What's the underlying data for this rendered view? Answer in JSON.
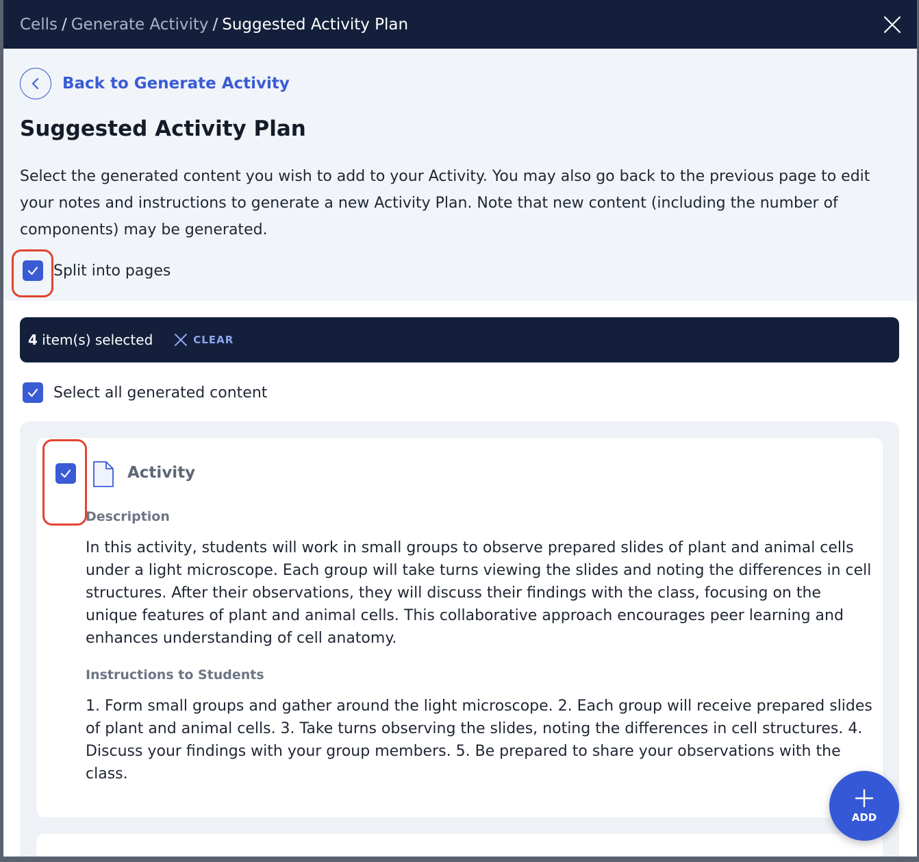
{
  "header": {
    "breadcrumb": [
      "Cells",
      "Generate Activity",
      "Suggested Activity Plan"
    ],
    "separator": "/"
  },
  "back_link": {
    "label": "Back to Generate Activity"
  },
  "page": {
    "title": "Suggested Activity Plan",
    "intro": "Select the generated content you wish to add to your Activity. You may also go back to the previous page to edit your notes and instructions to generate a new Activity Plan. Note that new content (including the number of components) may be generated."
  },
  "split_pages": {
    "label": "Split into pages",
    "checked": true
  },
  "selection_bar": {
    "count": "4",
    "suffix": " item(s) selected",
    "clear_label": "CLEAR"
  },
  "select_all": {
    "label": "Select all generated content",
    "checked": true
  },
  "activity_card": {
    "title": "Activity",
    "checked": true,
    "description_label": "Description",
    "description": "In this activity, students will work in small groups to observe prepared slides of plant and animal cells under a light microscope. Each group will take turns viewing the slides and noting the differences in cell structures. After their observations, they will discuss their findings with the class, focusing on the unique features of plant and animal cells. This collaborative approach encourages peer learning and enhances understanding of cell anatomy.",
    "instructions_label": "Instructions to Students",
    "instructions": "1. Form small groups and gather around the light microscope. 2. Each group will receive prepared slides of plant and animal cells. 3. Take turns observing the slides, noting the differences in cell structures. 4. Discuss your findings with your group members. 5. Be prepared to share your observations with the class."
  },
  "fab": {
    "label": "ADD"
  },
  "colors": {
    "header_bg": "#14203b",
    "accent": "#3a5bd4",
    "highlight": "#e0442f"
  }
}
